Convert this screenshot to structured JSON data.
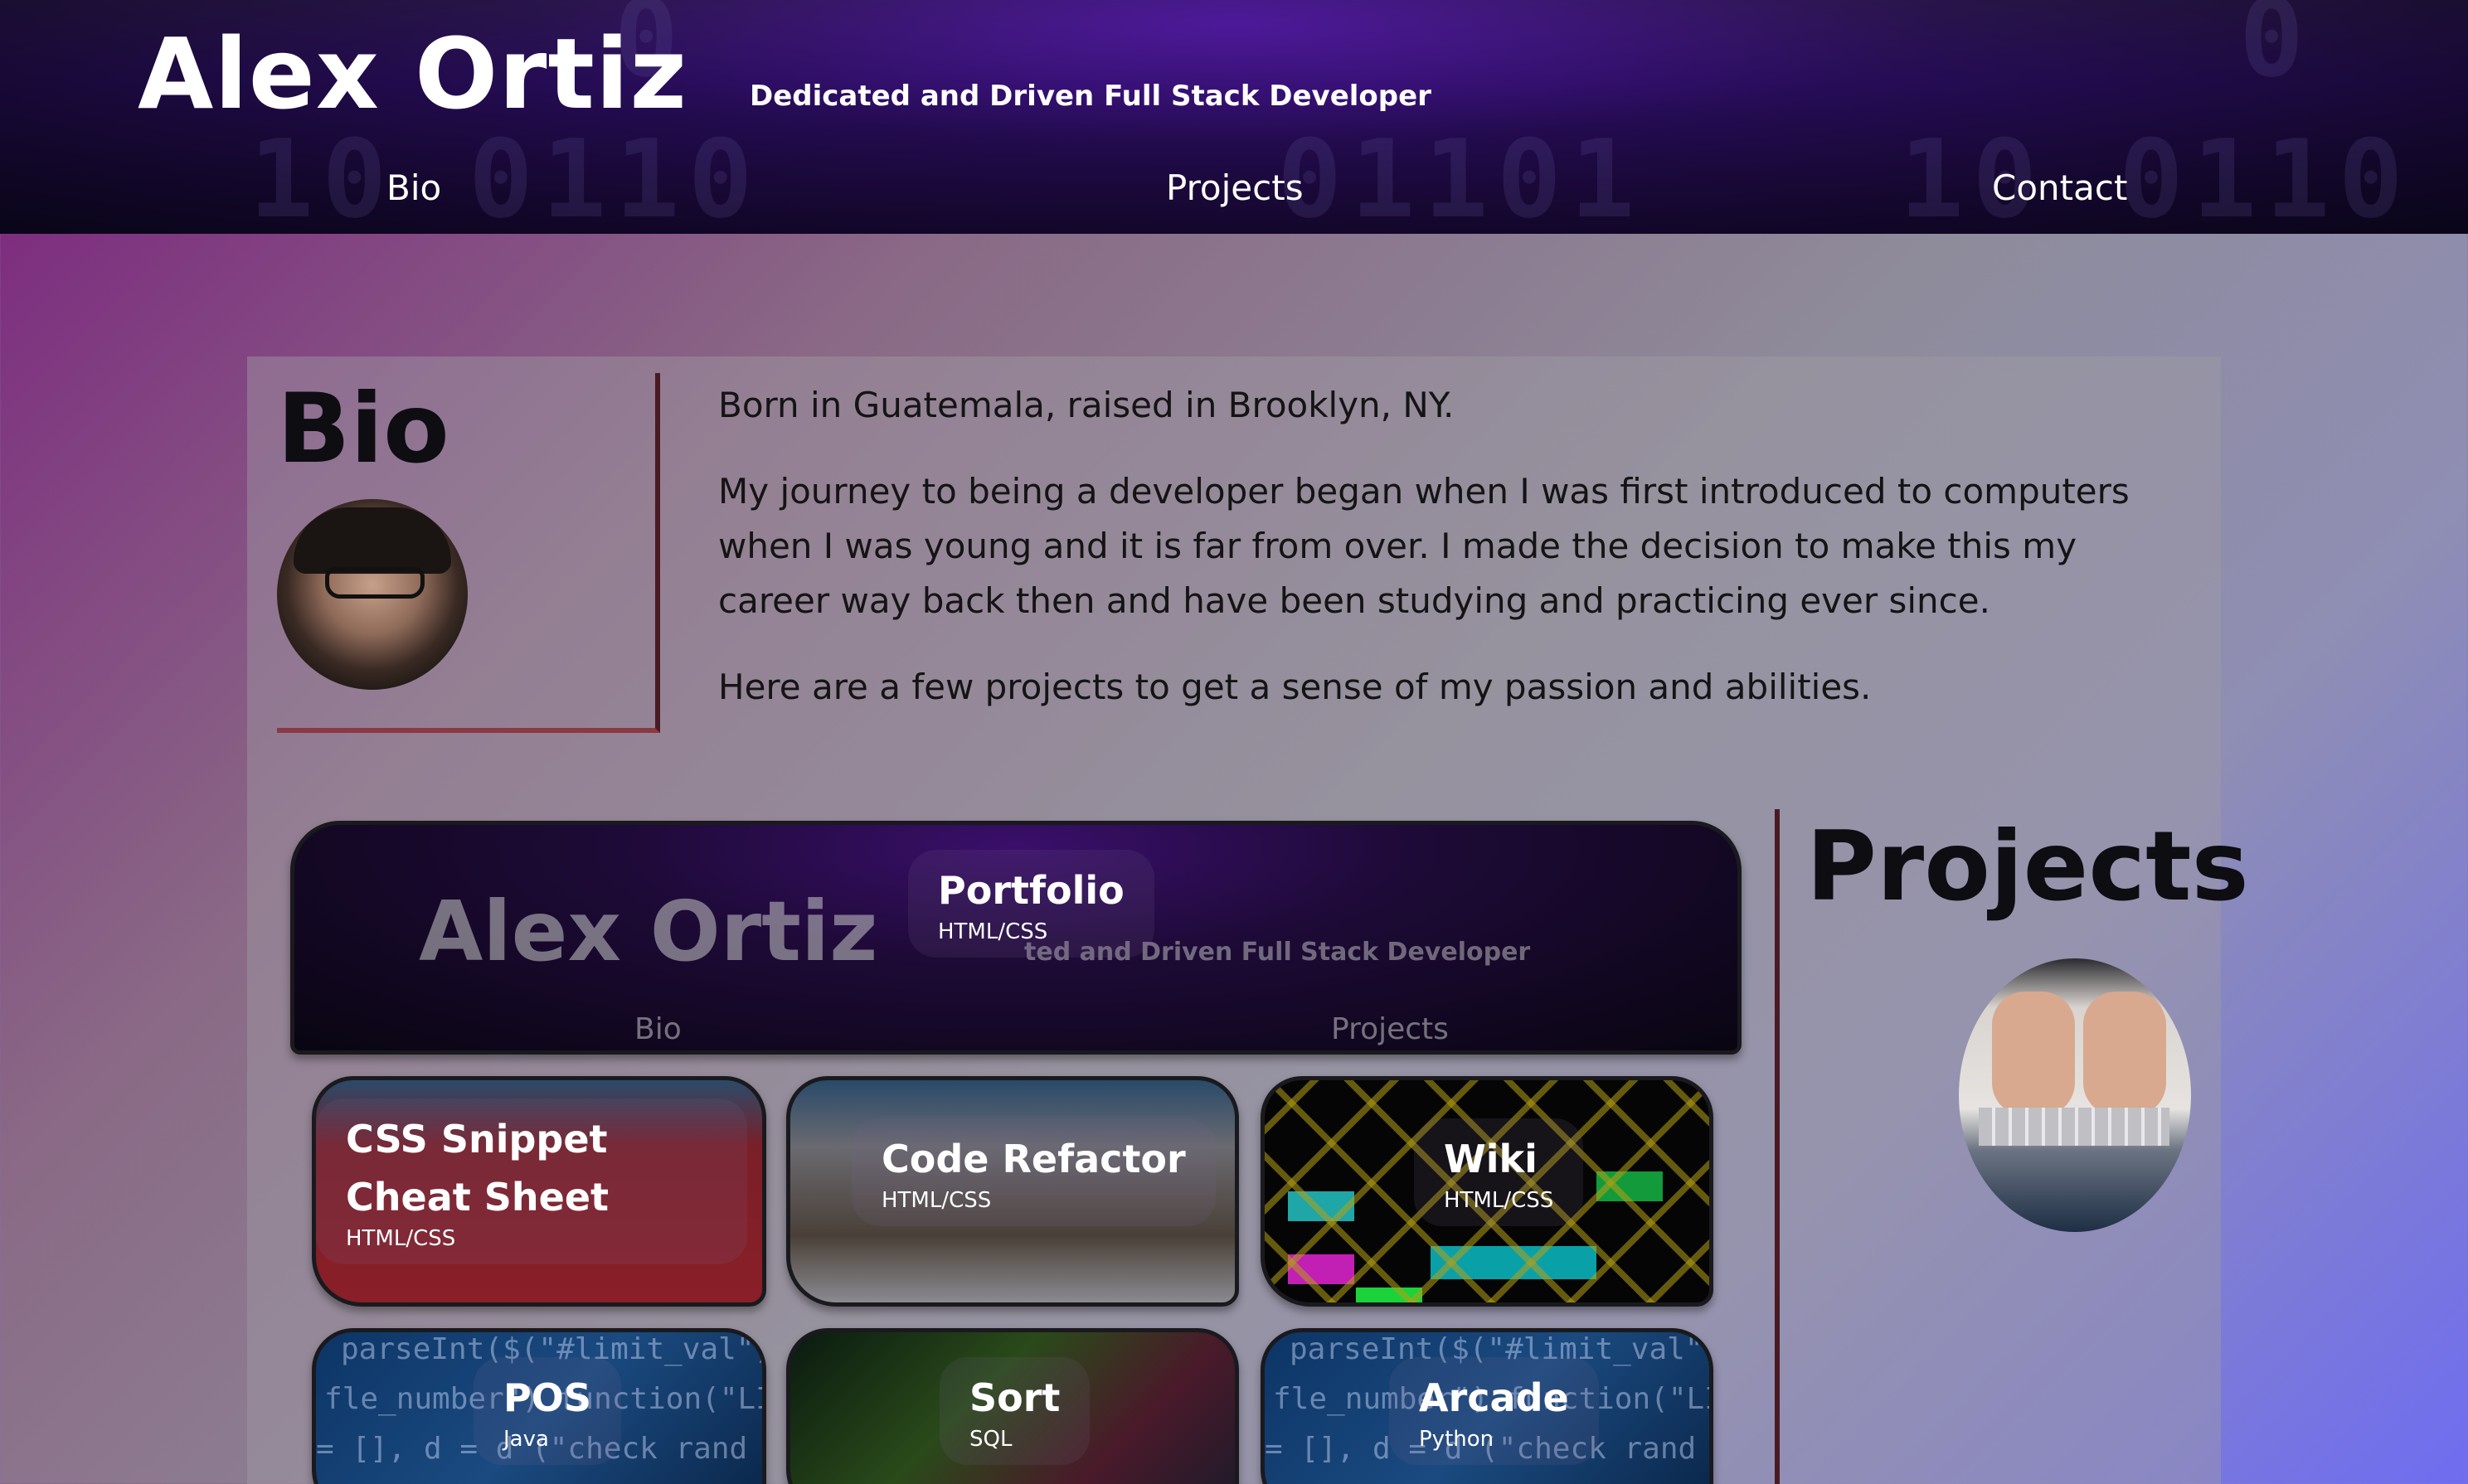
{
  "header": {
    "title": "Alex Ortiz",
    "tagline": "Dedicated and Driven Full Stack Developer",
    "binary_fragments": [
      "10 0110",
      "01101",
      "10 0110",
      "0",
      "0"
    ],
    "nav": [
      {
        "label": "Bio"
      },
      {
        "label": "Projects"
      },
      {
        "label": "Contact"
      }
    ]
  },
  "bio": {
    "heading": "Bio",
    "paragraphs": [
      "Born in Guatemala, raised in Brooklyn, NY.",
      "My journey to being a developer began when I was first introduced to computers when I was young and it is far from over. I made the decision to make this my career way back then and have been studying and practicing ever since.",
      "Here are a few projects to get a sense of my passion and abilities."
    ]
  },
  "projects": {
    "heading": "Projects",
    "portfolio_preview": {
      "title": "Alex Ortiz",
      "tagline": "ted and Driven Full Stack Developer",
      "nav_bio": "Bio",
      "nav_projects": "Projects"
    },
    "items": [
      {
        "name": "Portfolio",
        "tech": "HTML/CSS"
      },
      {
        "name": "CSS Snippet Cheat Sheet",
        "tech": "HTML/CSS"
      },
      {
        "name": "Code Refactor",
        "tech": "HTML/CSS"
      },
      {
        "name": "Wiki",
        "tech": "HTML/CSS"
      },
      {
        "name": "POS",
        "tech": "Java"
      },
      {
        "name": "Sort",
        "tech": "SQL"
      },
      {
        "name": "Arcade",
        "tech": "Python"
      }
    ],
    "code_snippets": [
      "parseInt($(\"#limit_val\").a()",
      "fle_number\") function(\"LIM",
      "= [], d = d  (\"check rand"
    ]
  },
  "colors": {
    "header_bg": "#1a0a36",
    "accent_border": "#4a1a22",
    "text_dark": "#141414"
  }
}
